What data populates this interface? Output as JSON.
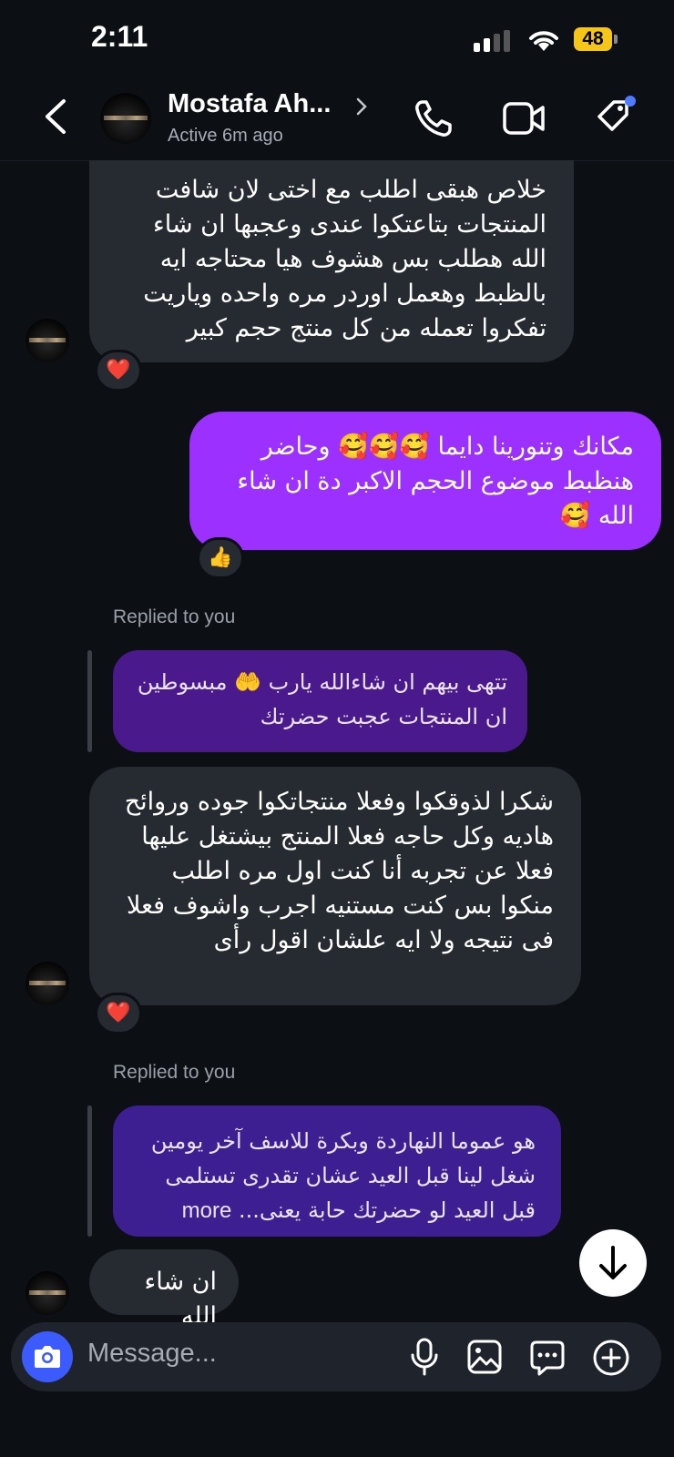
{
  "status_bar": {
    "time": "2:11",
    "battery": "48"
  },
  "header": {
    "name": "Mostafa Ah...",
    "status": "Active 6m ago"
  },
  "messages": [
    {
      "text": "خلاص هبقى اطلب مع اختى لان شافت المنتجات بتاعتكوا عندى وعجبها  ان شاء الله هطلب بس هشوف هيا محتاجه ايه بالظبط  وهعمل اوردر مره واحده  وياريت تفكروا تعمله من كل منتج حجم كبير",
      "reaction": "❤️"
    },
    {
      "text": "مكانك وتنورينا دايما 🥰🥰🥰 وحاضر هنظبط موضوع الحجم الاكبر دة ان شاء الله 🥰",
      "reaction": "👍"
    },
    {
      "replied_label": "Replied to you",
      "quote": "تتهى بيهم ان شاءالله يارب 🤲 مبسوطين ان المنتجات عجبت حضرتك"
    },
    {
      "text": "شكرا لذوقكوا وفعلا منتجاتكوا جوده وروائح هاديه وكل حاجه فعلا المنتج بيشتغل عليها فعلا  عن تجربه أنا كنت اول مره اطلب منكوا  بس كنت مستنيه اجرب واشوف فعلا فى نتيجه  ولا ايه علشان اقول رأى",
      "reaction": "❤️"
    },
    {
      "replied_label": "Replied to you",
      "quote_lines": [
        "هو عموما النهاردة وبكرة للاسف آخر يومين",
        "شغل لينا قبل العيد عشان تقدرى تستلمى",
        "قبل العيد لو حضرتك حابة يعنى..."
      ],
      "more": "more"
    },
    {
      "text": "ان شاء الله"
    }
  ],
  "composer": {
    "placeholder": "Message..."
  },
  "icons": [
    "back-icon",
    "chevron-right-icon",
    "phone-icon",
    "video-icon",
    "tag-icon",
    "camera-icon",
    "mic-icon",
    "image-icon",
    "sticker-icon",
    "plus-icon",
    "arrow-down-icon"
  ],
  "colors": {
    "background": "#0c0f14",
    "incoming": "#262a31",
    "outgoing": "#9b30ff",
    "quote": "#4a1a8c",
    "camera": "#3b5bfd",
    "battery": "#f5c518",
    "notification_dot": "#4f7bff"
  }
}
